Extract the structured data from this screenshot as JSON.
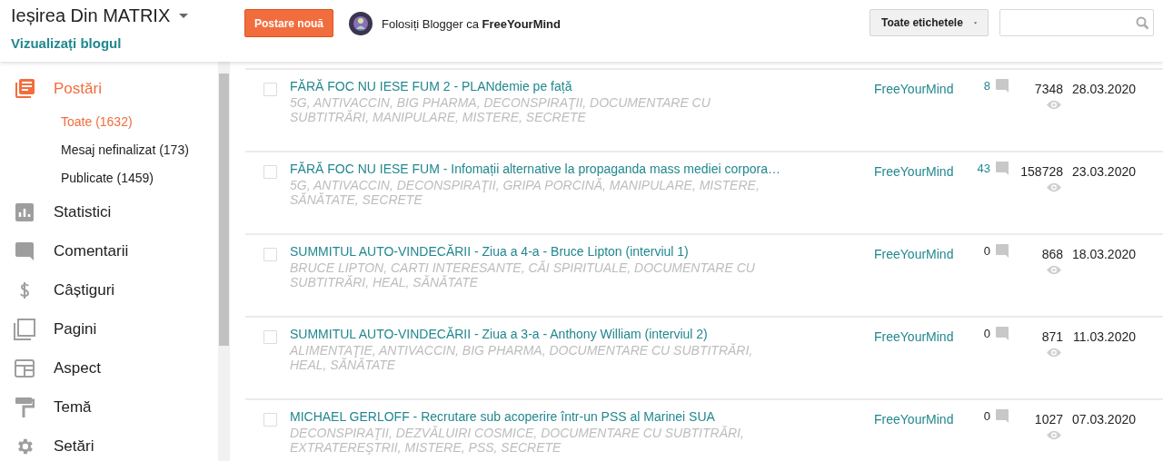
{
  "header": {
    "blog_title": "Ieșirea Din MATRIX",
    "view_blog": "Vizualizați blogul",
    "new_post": "Postare nouă",
    "user_text": "Folosiți Blogger ca **FreeYourMind**",
    "labels_dropdown": "Toate etichetele"
  },
  "sidebar": {
    "items": [
      {
        "label": "Postări",
        "kind": "posts",
        "selected": true,
        "children": [
          {
            "label": "Toate (1632)",
            "selected": true
          },
          {
            "label": "Mesaj nefinalizat (173)",
            "selected": false
          },
          {
            "label": "Publicate (1459)",
            "selected": false
          }
        ]
      },
      {
        "label": "Statistici",
        "kind": "stats",
        "selected": false
      },
      {
        "label": "Comentarii",
        "kind": "comments",
        "selected": false
      },
      {
        "label": "Câștiguri",
        "kind": "earnings",
        "selected": false
      },
      {
        "label": "Pagini",
        "kind": "pages",
        "selected": false
      },
      {
        "label": "Aspect",
        "kind": "layout",
        "selected": false
      },
      {
        "label": "Temă",
        "kind": "theme",
        "selected": false
      },
      {
        "label": "Setări",
        "kind": "settings",
        "selected": false
      }
    ]
  },
  "posts": [
    {
      "title": "FĂRĂ FOC NU IESE FUM 2 - PLANdemie pe față",
      "tags": [
        "5G,",
        "ANTIVACCIN,",
        "BIG PHARMA,",
        "DECONSPIRAŢII,",
        "DOCUMENTARE CU SUBTITRĂRI,",
        "MANIPULARE,",
        "MISTERE,",
        "SECRETE"
      ],
      "author": "FreeYourMind",
      "comments": "8",
      "views": "7348",
      "date": "28.03.2020",
      "checked": false
    },
    {
      "title": "FĂRĂ FOC NU IESE FUM - Infomații alternative la propaganda mass mediei corpora…",
      "tags": [
        "5G,",
        "ANTIVACCIN,",
        "DECONSPIRAŢII,",
        "GRIPA PORCINĂ,",
        "MANIPULARE,",
        "MISTERE,",
        "SĂNĂTATE,",
        "SECRETE"
      ],
      "author": "FreeYourMind",
      "comments": "43",
      "views": "158728",
      "date": "23.03.2020",
      "checked": false
    },
    {
      "title": "SUMMITUL AUTO-VINDECĂRII - Ziua a 4-a - Bruce Lipton (interviul 1)",
      "tags": [
        "BRUCE LIPTON,",
        "CARTI INTERESANTE,",
        "CĂI SPIRITUALE,",
        "DOCUMENTARE CU SUBTITRĂRI,",
        "HEAL,",
        "SĂNĂTATE"
      ],
      "author": "FreeYourMind",
      "comments": "0",
      "views": "868",
      "date": "18.03.2020",
      "checked": false
    },
    {
      "title": "SUMMITUL AUTO-VINDECĂRII - Ziua a 3-a - Anthony William (interviul 2)",
      "tags": [
        "ALIMENTAŢIE,",
        "ANTIVACCIN,",
        "BIG PHARMA,",
        "DOCUMENTARE CU SUBTITRĂRI,",
        "HEAL,",
        "SĂNĂTATE"
      ],
      "author": "FreeYourMind",
      "comments": "0",
      "views": "871",
      "date": "11.03.2020",
      "checked": false
    },
    {
      "title": "MICHAEL GERLOFF - Recrutare sub acoperire într-un PSS al Marinei SUA",
      "tags": [
        "DECONSPIRAŢII,",
        "DEZVĂLUIRI COSMICE,",
        "DOCUMENTARE CU SUBTITRĂRI,",
        "EXTRATEREŞTRII,",
        "MISTERE,",
        "PSS,",
        "SECRETE"
      ],
      "author": "FreeYourMind",
      "comments": "0",
      "views": "1027",
      "date": "07.03.2020",
      "checked": false
    }
  ]
}
